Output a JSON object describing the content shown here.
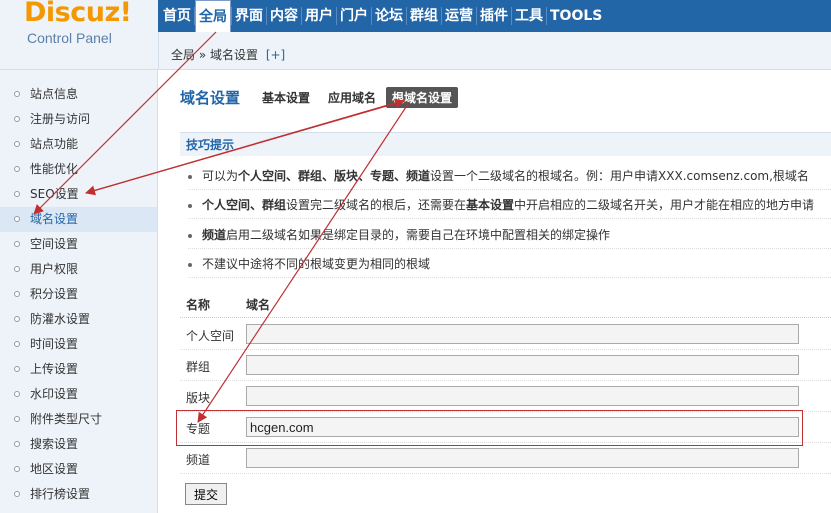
{
  "logo": {
    "brand": "Discuz!",
    "subtitle": "Control Panel"
  },
  "topnav": {
    "items": [
      "首页",
      "全局",
      "界面",
      "内容",
      "用户",
      "门户",
      "论坛",
      "群组",
      "运营",
      "插件",
      "工具",
      "TOOLS"
    ],
    "active_index": 1
  },
  "breadcrumb": {
    "path": "全局 » 域名设置",
    "add": "[+]"
  },
  "sidebar": {
    "items": [
      "站点信息",
      "注册与访问",
      "站点功能",
      "性能优化",
      "SEO设置",
      "域名设置",
      "空间设置",
      "用户权限",
      "积分设置",
      "防灌水设置",
      "时间设置",
      "上传设置",
      "水印设置",
      "附件类型尺寸",
      "搜索设置",
      "地区设置",
      "排行榜设置"
    ],
    "active_index": 5
  },
  "main": {
    "title": "域名设置",
    "tabs": [
      "基本设置",
      "应用域名",
      "根域名设置"
    ],
    "active_tab": 2,
    "tips_title": "技巧提示",
    "tips": [
      {
        "pre": "可以为",
        "bold": "个人空间、群组、版块、专题、频道",
        "post": "设置一个二级域名的根域名。例：用户申请XXX.comsenz.com,根域名",
        "tail": ""
      },
      {
        "pre": "",
        "bold": "个人空间、群组",
        "post": "设置完二级域名的根后，还需要在",
        "bold2": "基本设置",
        "tail": "中开启相应的二级域名开关，用户才能在相应的地方申请"
      },
      {
        "pre": "",
        "bold": "频道",
        "post": "启用二级域名如果是绑定目录的，需要自己在环境中配置相关的绑定操作",
        "tail": ""
      },
      {
        "pre": "不建议中途将不同的根域变更为相同的根域",
        "bold": "",
        "post": "",
        "tail": ""
      }
    ],
    "form": {
      "col_name": "名称",
      "col_domain": "域名",
      "rows": [
        {
          "label": "个人空间",
          "value": ""
        },
        {
          "label": "群组",
          "value": ""
        },
        {
          "label": "版块",
          "value": ""
        },
        {
          "label": "专题",
          "value": "hcgen.com"
        },
        {
          "label": "频道",
          "value": ""
        }
      ]
    },
    "submit_label": "提交"
  },
  "colors": {
    "nav_blue": "#2366a8",
    "logo_orange": "#f39800",
    "annotation_red": "#c03030",
    "panel_bg": "#eef3f9"
  }
}
